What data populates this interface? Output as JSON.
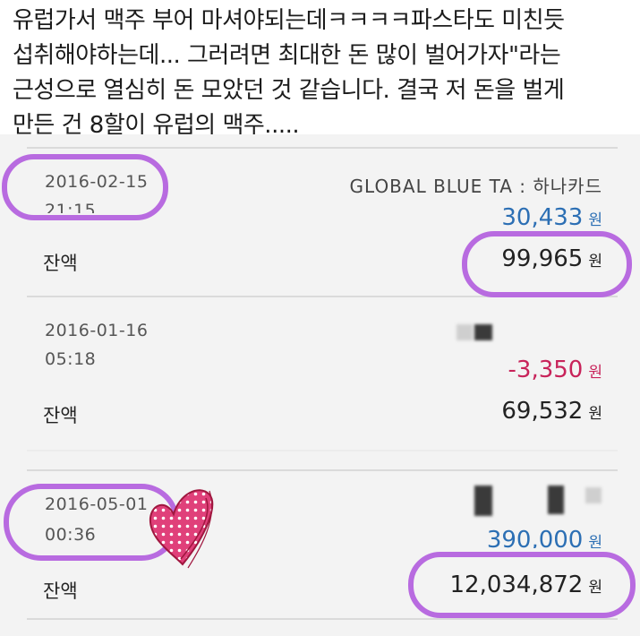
{
  "post": {
    "lines": [
      "유럽가서 맥주 부어 마셔야되는데ㅋㅋㅋㅋ파스타도 미친듯",
      "섭취해야하는데... 그러려면 최대한 돈 많이 벌어가자\"라는",
      "근성으로 열심히 돈 모았던 것 같습니다. 결국 저 돈을 벌게",
      "만든 건 8할이 유럽의 맥주....."
    ]
  },
  "transactions": [
    {
      "date": "2016-02-15",
      "time": "21:15",
      "merchant": "GLOBAL BLUE TA : 하나카드",
      "amount": "30,433",
      "currency": "원",
      "balance_label": "잔액",
      "balance": "99,965",
      "amount_color": "#2c6fb4"
    },
    {
      "date": "2016-01-16",
      "time": "05:18",
      "merchant": "",
      "amount": "-3,350",
      "currency": "원",
      "balance_label": "잔액",
      "balance": "69,532",
      "amount_color": "#c8235a"
    },
    {
      "date": "2016-05-01",
      "time": "00:36",
      "merchant": "",
      "amount": "390,000",
      "currency": "원",
      "balance_label": "잔액",
      "balance": "12,034,872",
      "amount_color": "#2c6fb4"
    }
  ],
  "annotations": {
    "highlight_color": "#b86be0",
    "heart_color": "#e0407a",
    "heart_icon": "polka-dot-heart-icon"
  }
}
